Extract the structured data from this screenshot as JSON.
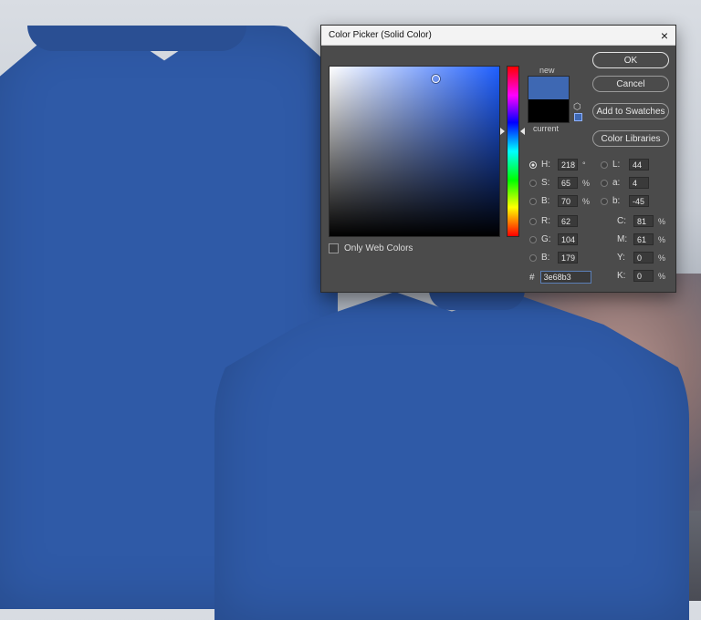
{
  "dialog": {
    "title": "Color Picker (Solid Color)",
    "close_glyph": "×",
    "buttons": {
      "ok": "OK",
      "cancel": "Cancel",
      "add_to_swatches": "Add to Swatches",
      "color_libraries": "Color Libraries"
    },
    "swatches": {
      "new_label": "new",
      "current_label": "current",
      "new_color": "#3e68b3",
      "current_color": "#000000"
    },
    "only_web_colors": "Only Web Colors",
    "hsb": {
      "h": {
        "label": "H:",
        "value": "218",
        "unit": "°"
      },
      "s": {
        "label": "S:",
        "value": "65",
        "unit": "%"
      },
      "b": {
        "label": "B:",
        "value": "70",
        "unit": "%"
      }
    },
    "rgb": {
      "r": {
        "label": "R:",
        "value": "62"
      },
      "g": {
        "label": "G:",
        "value": "104"
      },
      "b": {
        "label": "B:",
        "value": "179"
      }
    },
    "lab": {
      "l": {
        "label": "L:",
        "value": "44"
      },
      "a": {
        "label": "a:",
        "value": "4"
      },
      "b": {
        "label": "b:",
        "value": "-45"
      }
    },
    "cmyk": {
      "c": {
        "label": "C:",
        "value": "81",
        "unit": "%"
      },
      "m": {
        "label": "M:",
        "value": "61",
        "unit": "%"
      },
      "y": {
        "label": "Y:",
        "value": "0",
        "unit": "%"
      },
      "k": {
        "label": "K:",
        "value": "0",
        "unit": "%"
      }
    },
    "hex": {
      "label": "#",
      "value": "3e68b3"
    }
  },
  "colors": {
    "shirt": "#2f5aa7",
    "dialog_bg": "#4b4b4b"
  }
}
